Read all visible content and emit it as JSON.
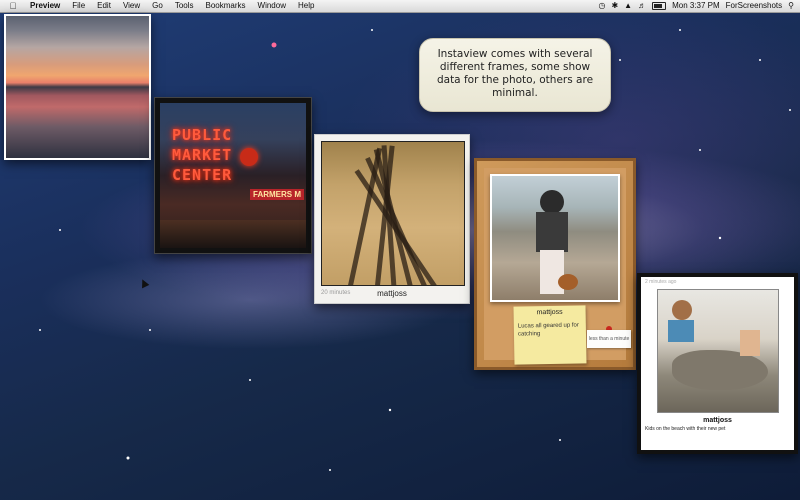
{
  "menubar": {
    "apple_icon": "apple-icon",
    "app_name": "Preview",
    "items": [
      "File",
      "Edit",
      "View",
      "Go",
      "Tools",
      "Bookmarks",
      "Window",
      "Help"
    ],
    "clock": "Mon 3:37 PM",
    "user": "ForScreenshots",
    "tray_icons": [
      "time-machine-icon",
      "bluetooth-icon",
      "wifi-icon",
      "volume-icon",
      "battery-icon",
      "spotlight-icon"
    ]
  },
  "tooltip": {
    "text": "Instaview comes with several different frames, some show data for the photo, others are minimal."
  },
  "photos": {
    "sunset": {},
    "market": {
      "sign_line1": "PUBLIC",
      "sign_line2": "MARKET",
      "sign_line3": "CENTER",
      "farmers": "FARMERS M"
    },
    "shadows": {
      "time": "20 minutes",
      "user": "mattjoss"
    },
    "cork": {
      "user": "mattjoss",
      "caption": "Lucas all geared up for catching",
      "time": "less than a minute"
    },
    "beach": {
      "time": "2 minutes ago",
      "user": "mattjoss",
      "caption": "Kids on the beach with their new pet"
    }
  },
  "colors": {
    "desktop_background": "#1a2f5c",
    "menubar": "#e6e6e6",
    "tooltip_bg": "#f1efe0",
    "cork": "#d29d63",
    "neon": "#ff5a3c"
  }
}
